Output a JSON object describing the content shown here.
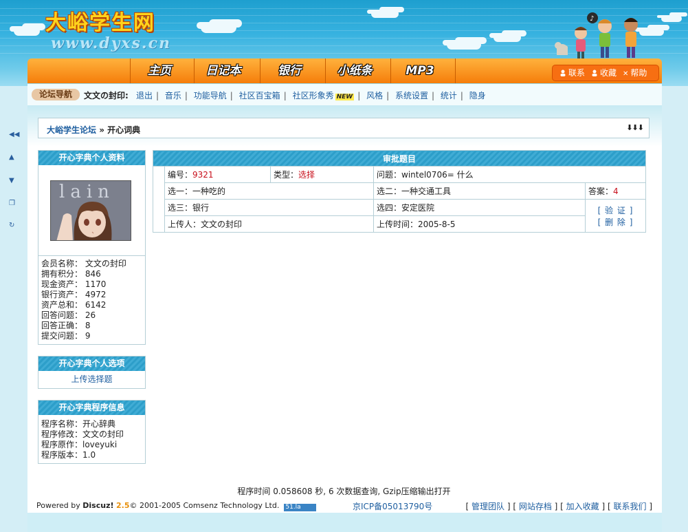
{
  "header": {
    "site_name": "大峪学生网",
    "site_url": "www.dyxs.cn"
  },
  "nav": {
    "items": [
      "主页",
      "日记本",
      "银行",
      "小纸条",
      "MP3"
    ]
  },
  "toplinks": {
    "contact": "联系",
    "favorite": "收藏",
    "help": "帮助"
  },
  "subnav": {
    "tag": "论坛导航",
    "user": "文文の封印:",
    "links": [
      "退出",
      "音乐",
      "功能导航",
      "社区百宝箱",
      "社区形象秀",
      "风格",
      "系统设置",
      "统计",
      "隐身"
    ],
    "new_badge": "NEW"
  },
  "breadcrumb": {
    "forum": "大峪学生论坛",
    "separator": " » ",
    "current": "开心词典"
  },
  "profile": {
    "title": "开心字典个人资料",
    "avatar_text": "lain",
    "lines": [
      "会员名称： 文文の封印",
      "拥有积分： 846",
      "现金资产： 1170",
      "银行资产： 4972",
      "资产总和： 6142",
      "回答问题： 26",
      "回答正确： 8",
      "提交问题： 9"
    ]
  },
  "options": {
    "title": "开心字典个人选项",
    "link": "上传选择题"
  },
  "program": {
    "title": "开心字典程序信息",
    "lines": [
      "程序名称：开心辞典",
      "程序修改：文文の封印",
      "程序原作：loveyuki",
      "程序版本：1.0"
    ]
  },
  "approval": {
    "title": "审批题目",
    "id_label": "编号：",
    "id_value": "9321",
    "type_label": "类型：",
    "type_value": "选择",
    "question": "问题：wintel0706= 什么",
    "opt1": "选一：一种吃的",
    "opt2": "选二：一种交通工具",
    "answer_label": "答案：",
    "answer_value": "4",
    "opt3": "选三：银行",
    "opt4": "选四：安定医院",
    "verify": "[ 验 证 ]",
    "delete": "[ 删 除 ]",
    "uploader": "上传人：文文の封印",
    "upload_time": "上传时间：2005-8-5"
  },
  "footer": {
    "timing": "程序时间 0.058608 秒, 6 次数据查询, Gzip压缩输出打开",
    "powered_by": "Powered by ",
    "discuz": "Discuz!",
    "version": "2.5",
    "copyright": "© 2001-2005 Comsenz Technology Ltd.",
    "stats_badge": "51.la",
    "icp": "京ICP备05013790号",
    "links": [
      "管理团队",
      "网站存档",
      "加入收藏",
      "联系我们"
    ]
  },
  "colors": {
    "nav_orange": "#f57d0a",
    "header_blue": "#2d9ec9",
    "link_blue": "#1f5fa0",
    "accent_red": "#c8101c"
  }
}
